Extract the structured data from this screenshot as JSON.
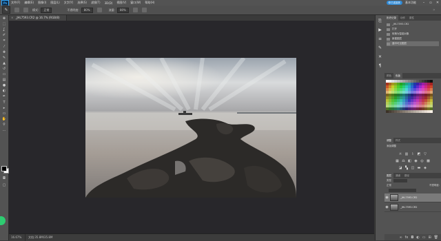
{
  "app": {
    "logo": "Ps",
    "menu": [
      "文件(F)",
      "编辑(E)",
      "图像(I)",
      "图层(L)",
      "文字(Y)",
      "选择(S)",
      "滤镜(T)",
      "3D(D)",
      "视图(V)",
      "窗口(W)",
      "帮助(H)"
    ],
    "badge": "你已连接到",
    "cloud_label": "基本功能"
  },
  "options": {
    "mode_label": "模式:",
    "mode_value": "正常",
    "opacity_label": "不透明度:",
    "opacity_value": "80%",
    "flow_label": "流量:",
    "flow_value": "80%"
  },
  "document": {
    "tab_title": "_JHL7593.CR2 @ 16.7% (RGB/8)",
    "zoom": "16.67%",
    "doc_info": "文档:35.8M/35.8M"
  },
  "history": {
    "tabs": [
      "历史记录",
      "动作",
      "属性"
    ],
    "items": [
      "_JHL7593.CR2",
      "打开",
      "转换为智能对象",
      "新建图层",
      "盖印可见图层"
    ],
    "selected_index": 4
  },
  "swatches": {
    "tabs": [
      "颜色",
      "色板"
    ]
  },
  "adjustments": {
    "tabs": [
      "调整",
      "样式"
    ],
    "label": "添加调整"
  },
  "layers": {
    "tabs": [
      "图层",
      "通道",
      "路径"
    ],
    "kind_label": "类型",
    "blend_label": "正常",
    "opacity_label": "不透明度:",
    "items": [
      {
        "name": "_JHL7593.CR2",
        "selected": true
      },
      {
        "name": "_JHL7593.CR2",
        "selected": false
      }
    ]
  },
  "colors": {
    "accent": "#31a8ff",
    "panel": "#535353",
    "canvas": "#28272b"
  }
}
